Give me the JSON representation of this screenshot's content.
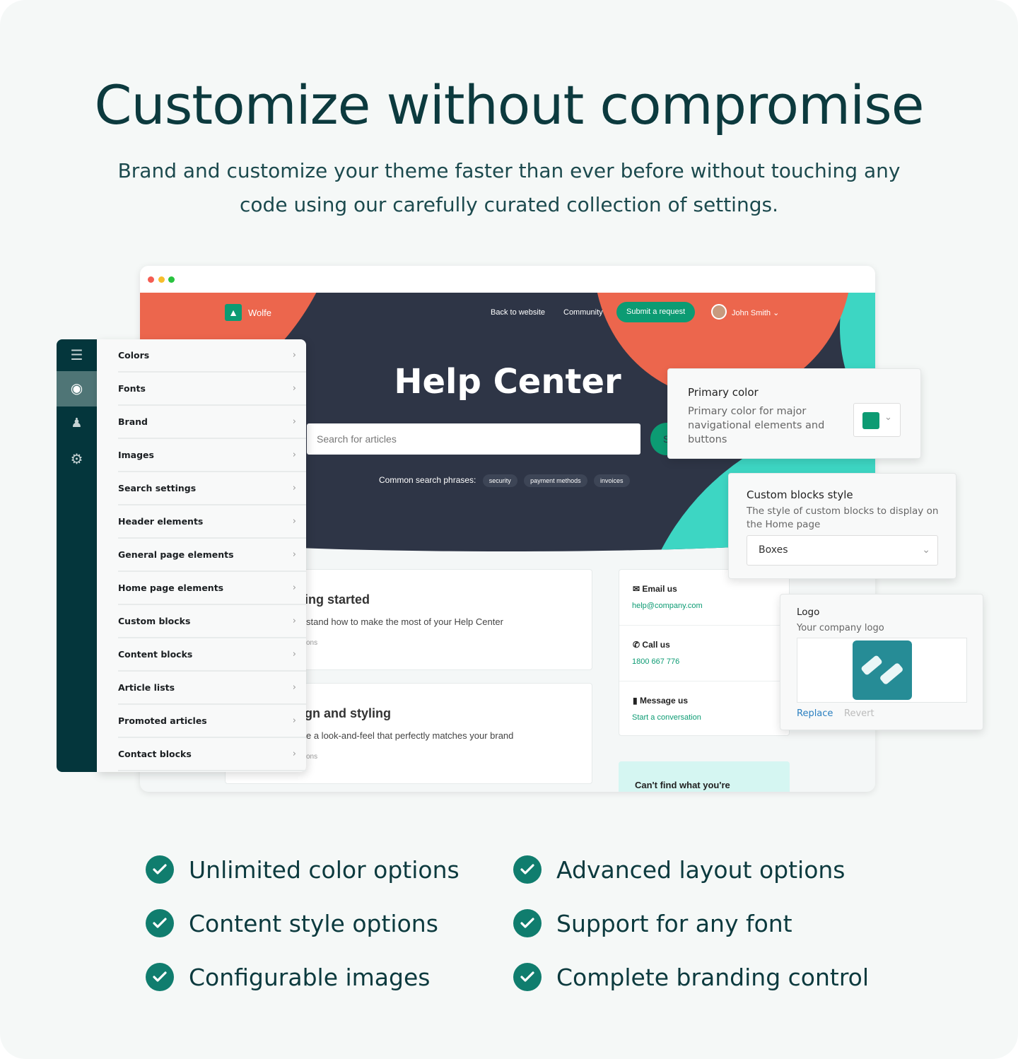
{
  "title": "Customize without compromise",
  "subtitle": "Brand and customize your theme faster than ever before without touching any code using our carefully curated collection of settings.",
  "colors": {
    "accent": "#0c9b73",
    "orange": "#ec664d",
    "teal": "#3dd6c3",
    "hero": "#2e3546",
    "sidebar": "#04363c"
  },
  "site": {
    "brand": "Wolfe",
    "nav": [
      "Back to website",
      "Community"
    ],
    "submit": "Submit a request",
    "user": "John Smith",
    "hero_title": "Help Center",
    "search_placeholder": "Search for articles",
    "search_button": "S",
    "phrases_label": "Common search phrases:",
    "phrases": [
      "security",
      "payment methods",
      "invoices"
    ]
  },
  "cards": [
    {
      "title": "ing started",
      "desc": "stand how to make the most of your Help Center",
      "meta": "ons"
    },
    {
      "title": "gn and styling",
      "desc": "e a look-and-feel that perfectly matches your brand",
      "meta": "ons"
    }
  ],
  "contact": [
    {
      "icon": "envelope-icon",
      "title": "Email us",
      "link": "help@company.com"
    },
    {
      "icon": "phone-icon",
      "title": "Call us",
      "link": "1800 667 776"
    },
    {
      "icon": "message-icon",
      "title": "Message us",
      "link": "Start a conversation"
    }
  ],
  "cant_find": "Can't find what you're",
  "sidebar": {
    "icons": [
      "menu-icon",
      "eye-icon",
      "user-lock-icon",
      "gear-icon"
    ],
    "items": [
      "Colors",
      "Fonts",
      "Brand",
      "Images",
      "Search settings",
      "Header elements",
      "General page elements",
      "Home page elements",
      "Custom blocks",
      "Content blocks",
      "Article lists",
      "Promoted articles",
      "Contact blocks"
    ]
  },
  "primary": {
    "title": "Primary color",
    "desc": "Primary color for major navigational elements and buttons",
    "value": "#0c9b73"
  },
  "blocks": {
    "title": "Custom blocks style",
    "desc": "The style of custom blocks to display on the Home page",
    "value": "Boxes"
  },
  "logo": {
    "title": "Logo",
    "desc": "Your company logo",
    "replace": "Replace",
    "revert": "Revert"
  },
  "features": [
    "Unlimited color options",
    "Advanced layout options",
    "Content style options",
    "Support for any font",
    "Configurable images",
    "Complete branding control"
  ]
}
